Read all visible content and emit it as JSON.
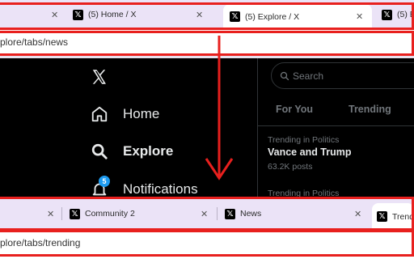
{
  "top_browser": {
    "tabs": [
      {
        "label": "",
        "close": "✕"
      },
      {
        "label": "(5) Home / X",
        "close": "✕"
      },
      {
        "label": "(5) Explore / X",
        "close": "✕"
      },
      {
        "label": "(5) E",
        "close": ""
      }
    ],
    "url": "plore/tabs/news"
  },
  "x_page": {
    "nav": [
      {
        "label": "Home",
        "icon": "home-icon"
      },
      {
        "label": "Explore",
        "icon": "search-icon"
      },
      {
        "label": "Notifications",
        "icon": "bell-icon",
        "badge": "5"
      }
    ],
    "search_placeholder": "Search",
    "tabs": [
      "For You",
      "Trending"
    ],
    "trends": [
      {
        "category": "Trending in Politics",
        "title": "Vance and Trump",
        "count": "63.2K posts"
      },
      {
        "category": "Trending in Politics",
        "title": "",
        "count": ""
      }
    ]
  },
  "bottom_browser": {
    "tabs": [
      {
        "label": "",
        "close": "✕"
      },
      {
        "label": "Community 2",
        "close": "✕"
      },
      {
        "label": "News",
        "close": "✕"
      },
      {
        "label": "Trend",
        "close": ""
      }
    ],
    "url": "plore/tabs/trending"
  },
  "colors": {
    "annotation": "#e8201e",
    "tabbar_bg": "#ebe3f7",
    "x_bg": "#000000",
    "x_text": "#e7e9ea",
    "x_muted": "#71767b"
  }
}
